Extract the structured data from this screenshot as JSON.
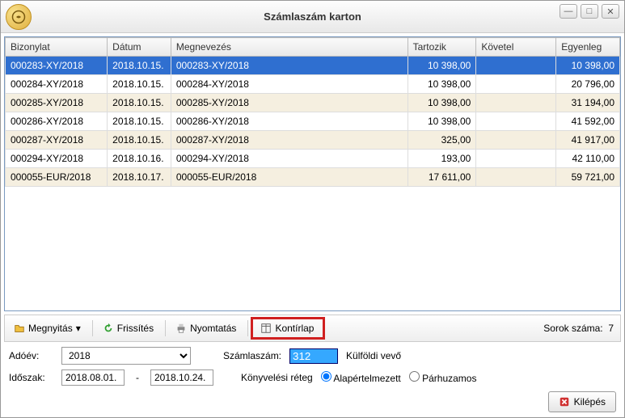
{
  "window": {
    "title": "Számlaszám karton"
  },
  "columns": {
    "c0": "Bizonylat",
    "c1": "Dátum",
    "c2": "Megnevezés",
    "c3": "Tartozik",
    "c4": "Követel",
    "c5": "Egyenleg"
  },
  "rows": [
    {
      "biz": "000283-XY/2018",
      "datum": "2018.10.15.",
      "megn": "000283-XY/2018",
      "tartozik": "10 398,00",
      "kovetel": "",
      "egyenleg": "10 398,00",
      "sel": true
    },
    {
      "biz": "000284-XY/2018",
      "datum": "2018.10.15.",
      "megn": "000284-XY/2018",
      "tartozik": "10 398,00",
      "kovetel": "",
      "egyenleg": "20 796,00"
    },
    {
      "biz": "000285-XY/2018",
      "datum": "2018.10.15.",
      "megn": "000285-XY/2018",
      "tartozik": "10 398,00",
      "kovetel": "",
      "egyenleg": "31 194,00",
      "alt": true
    },
    {
      "biz": "000286-XY/2018",
      "datum": "2018.10.15.",
      "megn": "000286-XY/2018",
      "tartozik": "10 398,00",
      "kovetel": "",
      "egyenleg": "41 592,00"
    },
    {
      "biz": "000287-XY/2018",
      "datum": "2018.10.15.",
      "megn": "000287-XY/2018",
      "tartozik": "325,00",
      "kovetel": "",
      "egyenleg": "41 917,00",
      "alt": true
    },
    {
      "biz": "000294-XY/2018",
      "datum": "2018.10.16.",
      "megn": "000294-XY/2018",
      "tartozik": "193,00",
      "kovetel": "",
      "egyenleg": "42 110,00"
    },
    {
      "biz": "000055-EUR/2018",
      "datum": "2018.10.17.",
      "megn": "000055-EUR/2018",
      "tartozik": "17 611,00",
      "kovetel": "",
      "egyenleg": "59 721,00",
      "alt": true
    }
  ],
  "toolbar": {
    "open": "Megnyitás",
    "refresh": "Frissítés",
    "print": "Nyomtatás",
    "kontirlap": "Kontírlap",
    "rowcount_label": "Sorok száma:",
    "rowcount_value": "7"
  },
  "form": {
    "adoev_label": "Adóév:",
    "adoev_value": "2018",
    "idoszak_label": "Időszak:",
    "idoszak_from": "2018.08.01.",
    "idoszak_to": "2018.10.24.",
    "szamlaszam_label": "Számlaszám:",
    "szamlaszam_value": "312",
    "szamlaszam_desc": "Külföldi vevő",
    "layer_label": "Könyvelési réteg",
    "layer_default": "Alapértelmezett",
    "layer_parallel": "Párhuzamos"
  },
  "footer": {
    "exit": "Kilépés"
  }
}
